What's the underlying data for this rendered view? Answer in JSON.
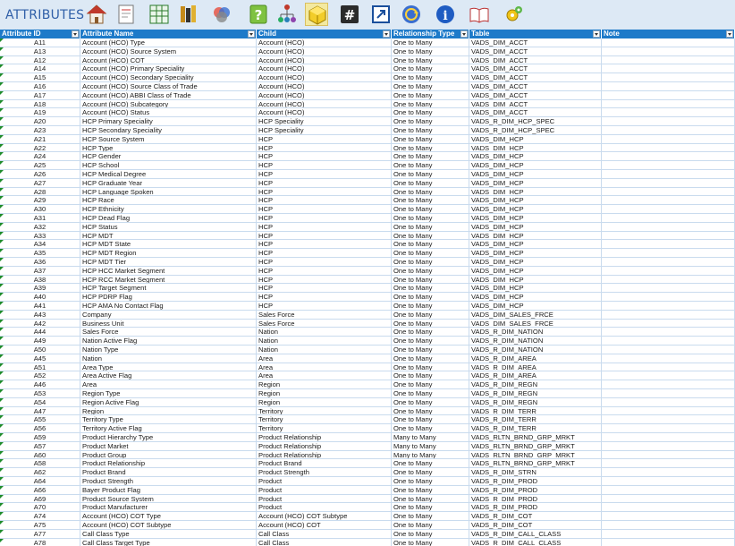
{
  "app": {
    "title": "ATTRIBUTES"
  },
  "toolbar": [
    {
      "name": "home-icon",
      "selected": false
    },
    {
      "name": "document-icon",
      "selected": false
    },
    {
      "name": "spreadsheet-icon",
      "selected": false
    },
    {
      "name": "books-icon",
      "selected": false
    },
    {
      "name": "venn-diagram-icon",
      "selected": false
    },
    {
      "name": "help-icon",
      "selected": false
    },
    {
      "name": "hierarchy-icon",
      "selected": false
    },
    {
      "name": "cube-icon",
      "selected": true
    },
    {
      "name": "hashtag-icon",
      "selected": false
    },
    {
      "name": "expand-icon",
      "selected": false
    },
    {
      "name": "refresh-icon",
      "selected": false
    },
    {
      "name": "info-icon",
      "selected": false
    },
    {
      "name": "open-book-icon",
      "selected": false
    },
    {
      "name": "settings-icon",
      "selected": false
    }
  ],
  "table": {
    "columns": [
      "Attribute ID",
      "Attribute Name",
      "Child",
      "Relationship Type",
      "Table",
      "Note"
    ],
    "rows": [
      [
        "A11",
        "Account (HCO) Type",
        "Account (HCO)",
        "One to Many",
        "VADS_DIM_ACCT",
        ""
      ],
      [
        "A13",
        "Account (HCO) Source System",
        "Account (HCO)",
        "One to Many",
        "VADS_DIM_ACCT",
        ""
      ],
      [
        "A12",
        "Account (HCO) COT",
        "Account (HCO)",
        "One to Many",
        "VADS_DIM_ACCT",
        ""
      ],
      [
        "A14",
        "Account (HCO) Primary Speciality",
        "Account (HCO)",
        "One to Many",
        "VADS_DIM_ACCT",
        ""
      ],
      [
        "A15",
        "Account (HCO) Secondary Speciality",
        "Account (HCO)",
        "One to Many",
        "VADS_DIM_ACCT",
        ""
      ],
      [
        "A16",
        "Account (HCO) Source Class of Trade",
        "Account (HCO)",
        "One to Many",
        "VADS_DIM_ACCT",
        ""
      ],
      [
        "A17",
        "Account (HCO) ABBI Class of Trade",
        "Account (HCO)",
        "One to Many",
        "VADS_DIM_ACCT",
        ""
      ],
      [
        "A18",
        "Account (HCO) Subcategory",
        "Account (HCO)",
        "One to Many",
        "VADS_DIM_ACCT",
        ""
      ],
      [
        "A19",
        "Account (HCO) Status",
        "Account (HCO)",
        "One to Many",
        "VADS_DIM_ACCT",
        ""
      ],
      [
        "A20",
        "HCP Primary Speciality",
        "HCP Speciality",
        "One to Many",
        "VADS_R_DIM_HCP_SPEC",
        ""
      ],
      [
        "A23",
        "HCP Secondary Speciality",
        "HCP Speciality",
        "One to Many",
        "VADS_R_DIM_HCP_SPEC",
        ""
      ],
      [
        "A21",
        "HCP Source System",
        "HCP",
        "One to Many",
        "VADS_DIM_HCP",
        ""
      ],
      [
        "A22",
        "HCP Type",
        "HCP",
        "One to Many",
        "VADS_DIM_HCP",
        ""
      ],
      [
        "A24",
        "HCP Gender",
        "HCP",
        "One to Many",
        "VADS_DIM_HCP",
        ""
      ],
      [
        "A25",
        "HCP School",
        "HCP",
        "One to Many",
        "VADS_DIM_HCP",
        ""
      ],
      [
        "A26",
        "HCP Medical Degree",
        "HCP",
        "One to Many",
        "VADS_DIM_HCP",
        ""
      ],
      [
        "A27",
        "HCP Graduate Year",
        "HCP",
        "One to Many",
        "VADS_DIM_HCP",
        ""
      ],
      [
        "A28",
        "HCP Language Spoken",
        "HCP",
        "One to Many",
        "VADS_DIM_HCP",
        ""
      ],
      [
        "A29",
        "HCP Race",
        "HCP",
        "One to Many",
        "VADS_DIM_HCP",
        ""
      ],
      [
        "A30",
        "HCP Ethnicity",
        "HCP",
        "One to Many",
        "VADS_DIM_HCP",
        ""
      ],
      [
        "A31",
        "HCP Dead Flag",
        "HCP",
        "One to Many",
        "VADS_DIM_HCP",
        ""
      ],
      [
        "A32",
        "HCP Status",
        "HCP",
        "One to Many",
        "VADS_DIM_HCP",
        ""
      ],
      [
        "A33",
        "HCP MDT",
        "HCP",
        "One to Many",
        "VADS_DIM_HCP",
        ""
      ],
      [
        "A34",
        "HCP MDT State",
        "HCP",
        "One to Many",
        "VADS_DIM_HCP",
        ""
      ],
      [
        "A35",
        "HCP MDT Region",
        "HCP",
        "One to Many",
        "VADS_DIM_HCP",
        ""
      ],
      [
        "A36",
        "HCP MDT Tier",
        "HCP",
        "One to Many",
        "VADS_DIM_HCP",
        ""
      ],
      [
        "A37",
        "HCP HCC Market Segment",
        "HCP",
        "One to Many",
        "VADS_DIM_HCP",
        ""
      ],
      [
        "A38",
        "HCP RCC Market Segment",
        "HCP",
        "One to Many",
        "VADS_DIM_HCP",
        ""
      ],
      [
        "A39",
        "HCP Target Segment",
        "HCP",
        "One to Many",
        "VADS_DIM_HCP",
        ""
      ],
      [
        "A40",
        "HCP PDRP Flag",
        "HCP",
        "One to Many",
        "VADS_DIM_HCP",
        ""
      ],
      [
        "A41",
        "HCP AMA No Contact Flag",
        "HCP",
        "One to Many",
        "VADS_DIM_HCP",
        ""
      ],
      [
        "A43",
        "Company",
        "Sales Force",
        "One to Many",
        "VADS_DIM_SALES_FRCE",
        ""
      ],
      [
        "A42",
        "Business Unit",
        "Sales Force",
        "One to Many",
        "VADS_DIM_SALES_FRCE",
        ""
      ],
      [
        "A44",
        "Sales Force",
        "Nation",
        "One to Many",
        "VADS_R_DIM_NATION",
        ""
      ],
      [
        "A49",
        "Nation Active Flag",
        "Nation",
        "One to Many",
        "VADS_R_DIM_NATION",
        ""
      ],
      [
        "A50",
        "Nation Type",
        "Nation",
        "One to Many",
        "VADS_R_DIM_NATION",
        ""
      ],
      [
        "A45",
        "Nation",
        "Area",
        "One to Many",
        "VADS_R_DIM_AREA",
        ""
      ],
      [
        "A51",
        "Area Type",
        "Area",
        "One to Many",
        "VADS_R_DIM_AREA",
        ""
      ],
      [
        "A52",
        "Area Active Flag",
        "Area",
        "One to Many",
        "VADS_R_DIM_AREA",
        ""
      ],
      [
        "A46",
        "Area",
        "Region",
        "One to Many",
        "VADS_R_DIM_REGN",
        ""
      ],
      [
        "A53",
        "Region Type",
        "Region",
        "One to Many",
        "VADS_R_DIM_REGN",
        ""
      ],
      [
        "A54",
        "Region Active Flag",
        "Region",
        "One to Many",
        "VADS_R_DIM_REGN",
        ""
      ],
      [
        "A47",
        "Region",
        "Territory",
        "One to Many",
        "VADS_R_DIM_TERR",
        ""
      ],
      [
        "A55",
        "Territory Type",
        "Territory",
        "One to Many",
        "VADS_R_DIM_TERR",
        ""
      ],
      [
        "A56",
        "Territory Active Flag",
        "Territory",
        "One to Many",
        "VADS_R_DIM_TERR",
        ""
      ],
      [
        "A59",
        "Product Hierarchy Type",
        "Product Relationship",
        "Many to Many",
        "VADS_RLTN_BRND_GRP_MRKT",
        ""
      ],
      [
        "A57",
        "Product Market",
        "Product Relationship",
        "Many to Many",
        "VADS_RLTN_BRND_GRP_MRKT",
        ""
      ],
      [
        "A60",
        "Product Group",
        "Product Relationship",
        "Many to Many",
        "VADS_RLTN_BRND_GRP_MRKT",
        ""
      ],
      [
        "A58",
        "Product Relationship",
        "Product Brand",
        "One to Many",
        "VADS_RLTN_BRND_GRP_MRKT",
        ""
      ],
      [
        "A62",
        "Product Brand",
        "Product Strength",
        "One to Many",
        "VADS_R_DIM_STRN",
        ""
      ],
      [
        "A64",
        "Product Strength",
        "Product",
        "One to Many",
        "VADS_R_DIM_PROD",
        ""
      ],
      [
        "A66",
        "Bayer Product Flag",
        "Product",
        "One to Many",
        "VADS_R_DIM_PROD",
        ""
      ],
      [
        "A69",
        "Product Source System",
        "Product",
        "One to Many",
        "VADS_R_DIM_PROD",
        ""
      ],
      [
        "A70",
        "Product Manufacturer",
        "Product",
        "One to Many",
        "VADS_R_DIM_PROD",
        ""
      ],
      [
        "A74",
        "Account (HCO) COT Type",
        "Account (HCO) COT Subtype",
        "One to Many",
        "VADS_R_DIM_COT",
        ""
      ],
      [
        "A75",
        "Account (HCO) COT Subtype",
        "Account (HCO) COT",
        "One to Many",
        "VADS_R_DIM_COT",
        ""
      ],
      [
        "A77",
        "Call Class Type",
        "Call Class",
        "One to Many",
        "VADS_R_DIM_CALL_CLASS",
        ""
      ],
      [
        "A78",
        "Call Class Target Type",
        "Call Class",
        "One to Many",
        "VADS_R_DIM_CALL_CLASS",
        ""
      ]
    ]
  },
  "colors": {
    "header": "#1d7ac9",
    "toolbar": "#dde9f5",
    "title": "#2f5fa8",
    "gridline": "#c9dbee",
    "marker": "#1e8c2a"
  }
}
